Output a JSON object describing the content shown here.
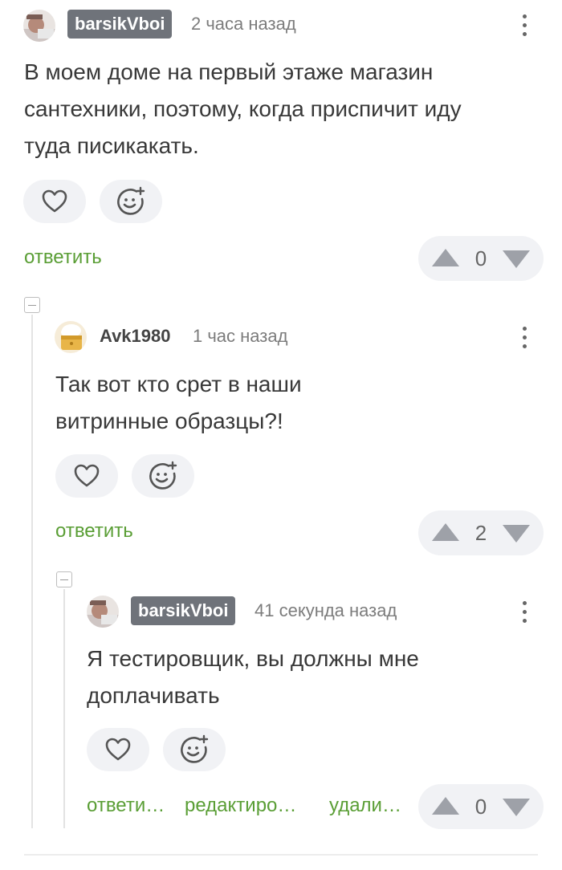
{
  "comments": [
    {
      "author": "barsikVboi",
      "time": "2 часа назад",
      "text_lines": [
        "В моем доме на первый этаже магазин",
        "сантехники, поэтому, когда приспичит иду",
        "туда писикакать."
      ],
      "actions": [
        "ответить"
      ],
      "votes": "0"
    },
    {
      "author": "Avk1980",
      "time": "1 час назад",
      "text_lines": [
        "Так вот кто срет в наши",
        "витринные образцы?!"
      ],
      "actions": [
        "ответить"
      ],
      "votes": "2"
    },
    {
      "author": "barsikVboi",
      "time": "41 секунда назад",
      "text_lines": [
        "Я тестировщик, вы должны мне",
        "доплачивать"
      ],
      "actions": [
        "ответи…",
        "редактиро…",
        "удали…"
      ],
      "votes": "0"
    }
  ],
  "icons": {
    "like": "heart-icon",
    "react": "smiley-plus-icon",
    "menu": "kebab-icon",
    "up": "upvote-icon",
    "down": "downvote-icon"
  },
  "colors": {
    "reply_link": "#5a9e35",
    "author_chip": "#6f737a",
    "pill_bg": "#f1f2f5",
    "arrow": "#9ea1a8"
  }
}
